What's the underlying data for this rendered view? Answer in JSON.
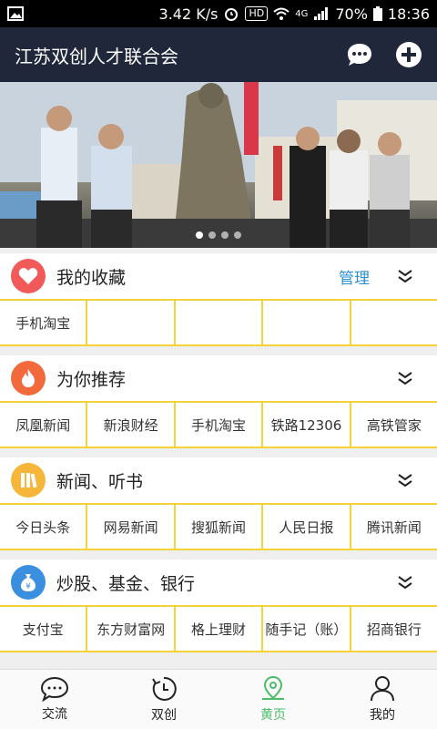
{
  "status": {
    "speed": "3.42 K/s",
    "hd": "HD",
    "network": "4G",
    "battery": "70%",
    "time": "18:36"
  },
  "app": {
    "title": "江苏双创人才联合会"
  },
  "sections": [
    {
      "title": "我的收藏",
      "manage": "管理",
      "items": [
        "手机淘宝",
        "",
        "",
        "",
        ""
      ]
    },
    {
      "title": "为你推荐",
      "items": [
        "凤凰新闻",
        "新浪财经",
        "手机淘宝",
        "铁路12306",
        "高铁管家"
      ]
    },
    {
      "title": "新闻、听书",
      "items": [
        "今日头条",
        "网易新闻",
        "搜狐新闻",
        "人民日报",
        "腾讯新闻"
      ]
    },
    {
      "title": "炒股、基金、银行",
      "items": [
        "支付宝",
        "东方财富网",
        "格上理财",
        "随手记（账）",
        "招商银行"
      ]
    }
  ],
  "tabs": [
    "交流",
    "双创",
    "黄页",
    "我的"
  ],
  "colors": {
    "accent": "#4cbb6a",
    "grid": "#f5d13a",
    "appbar": "#20273a",
    "manage": "#2a8fd0"
  }
}
